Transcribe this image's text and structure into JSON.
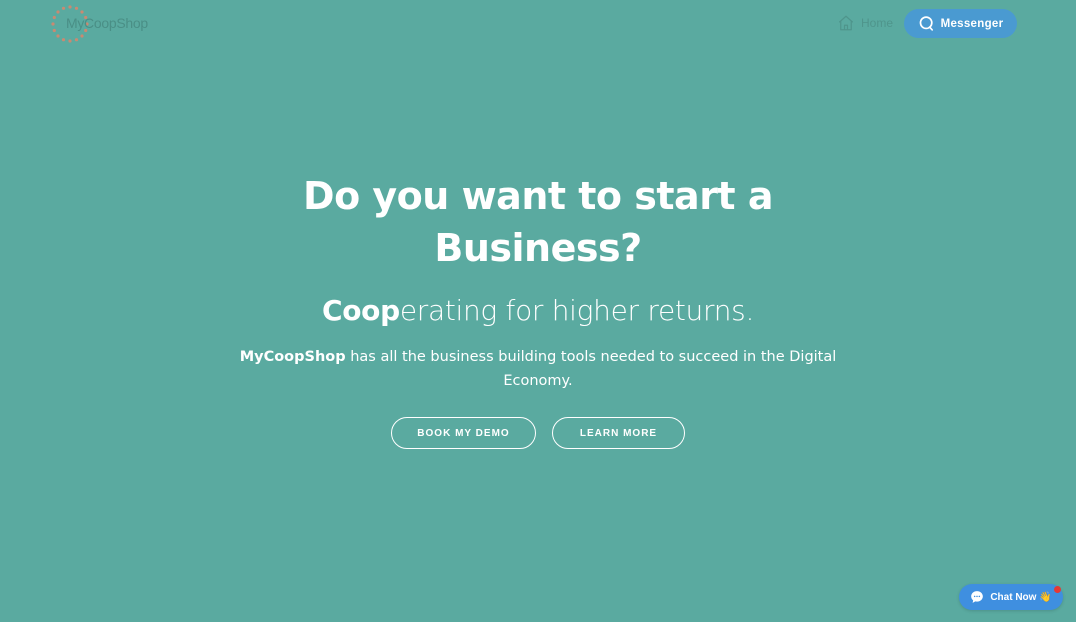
{
  "header": {
    "logo_text": "MyCoopShop",
    "nav_home_label": "Home",
    "messenger_label": "Messenger"
  },
  "hero": {
    "title": "Do you want to start a Business?",
    "subtitle_bold": "Coop",
    "subtitle_rest": "erating for higher returns.",
    "desc_bold": "MyCoopShop",
    "desc_rest": " has all the business building tools needed to succeed in the Digital Economy.",
    "cta_demo": "BOOK MY DEMO",
    "cta_learn": "LEARN MORE"
  },
  "chat": {
    "label": "Chat Now 👋"
  },
  "colors": {
    "background": "#5aaaa0",
    "messenger_button": "#4a9ad1",
    "chat_button": "#3f8fe0",
    "notification_dot": "#e53935"
  },
  "icons": {
    "home": "home-icon",
    "messenger": "chat-bubble-icon",
    "chat": "chat-icon"
  }
}
